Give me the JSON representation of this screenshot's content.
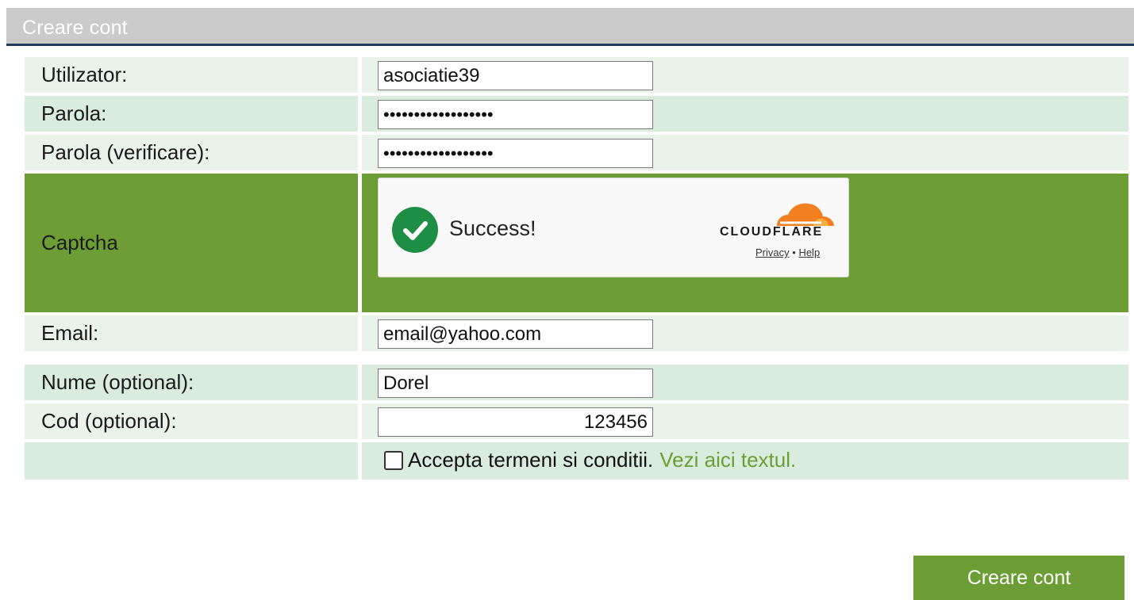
{
  "panel": {
    "title": "Creare cont"
  },
  "form": {
    "username": {
      "label": "Utilizator:",
      "value": "asociatie39"
    },
    "password": {
      "label": "Parola:",
      "value": "123456789012345678"
    },
    "password_confirm": {
      "label": "Parola (verificare):",
      "value": "123456789012345678"
    },
    "captcha": {
      "label": "Captcha",
      "status": "Success!",
      "provider": "CLOUDFLARE",
      "privacy_link": "Privacy",
      "separator": "•",
      "help_link": "Help"
    },
    "email": {
      "label": "Email:",
      "value": "email@yahoo.com"
    },
    "name": {
      "label": "Nume (optional):",
      "value": "Dorel"
    },
    "code": {
      "label": "Cod (optional):",
      "value": "123456"
    },
    "terms": {
      "checked": false,
      "text": "Accepta termeni si conditii.",
      "link_text": "Vezi aici textul."
    },
    "submit_label": "Creare cont"
  },
  "colors": {
    "accent": "#6d9e35",
    "header_bg": "#cbcbcb",
    "header_border": "#1d3b5e",
    "row_light": "#eaf3ea",
    "row_alt": "#d9ecdd",
    "success": "#1f8e45",
    "cloudflare_orange": "#f38020"
  }
}
